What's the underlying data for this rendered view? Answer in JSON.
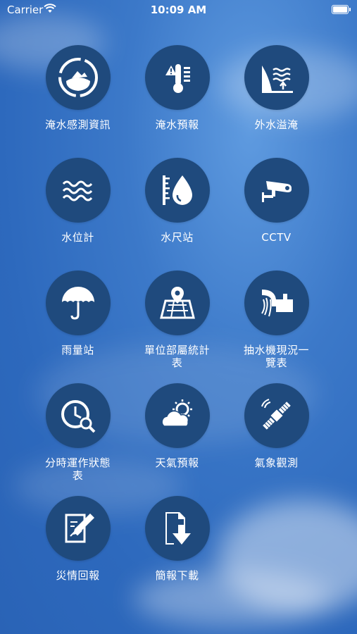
{
  "status_bar": {
    "carrier": "Carrier",
    "time": "10:09 AM"
  },
  "menu": [
    {
      "label": "淹水感測資訊",
      "icon": "flood-sensor-icon"
    },
    {
      "label": "淹水預報",
      "icon": "flood-forecast-icon"
    },
    {
      "label": "外水溢淹",
      "icon": "external-overflow-icon"
    },
    {
      "label": "水位計",
      "icon": "water-waves-icon"
    },
    {
      "label": "水尺站",
      "icon": "water-gauge-icon"
    },
    {
      "label": "CCTV",
      "icon": "cctv-camera-icon"
    },
    {
      "label": "雨量站",
      "icon": "umbrella-icon"
    },
    {
      "label": "單位部屬統計表",
      "icon": "map-pin-icon"
    },
    {
      "label": "抽水機現況一覽表",
      "icon": "pump-icon"
    },
    {
      "label": "分時運作狀態表",
      "icon": "clock-search-icon"
    },
    {
      "label": "天氣預報",
      "icon": "weather-icon"
    },
    {
      "label": "氣象觀測",
      "icon": "satellite-icon"
    },
    {
      "label": "災情回報",
      "icon": "report-edit-icon"
    },
    {
      "label": "簡報下載",
      "icon": "download-doc-icon"
    }
  ]
}
